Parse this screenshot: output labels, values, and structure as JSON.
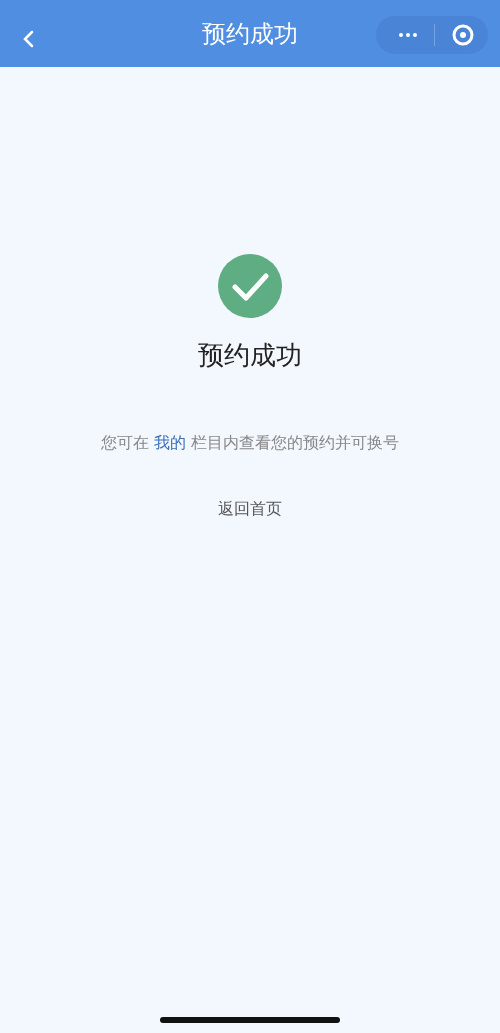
{
  "header": {
    "title": "预约成功"
  },
  "result": {
    "kind": "success",
    "title": "预约成功"
  },
  "hint": {
    "before": "您可在 ",
    "link": "我的",
    "after": " 栏目内查看您的预约并可换号"
  },
  "back_home": {
    "label": "返回首页"
  }
}
